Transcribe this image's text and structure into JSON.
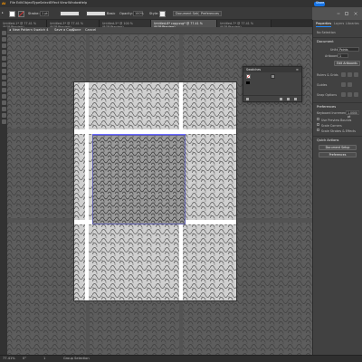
{
  "menubar": {
    "logo": "Ai",
    "items": [
      "File",
      "Edit",
      "Object",
      "Type",
      "Select",
      "Effect",
      "View",
      "Window",
      "Help"
    ],
    "share_label": "Share"
  },
  "controlbar": {
    "stroke_label": "Stroke:",
    "stroke_weight": "1 pt",
    "brush_label": "Basic",
    "opacity_label": "Opacity:",
    "opacity_value": "100%",
    "style_label": "Style:",
    "document_setup": "Document Setup",
    "preferences": "Preferences"
  },
  "tabs": [
    "Untitled-1* @ 77.41 % (RGB/Preview)",
    "Untitled-3* @ 77.41 % (RGB/Preview)",
    "Untitled-5* @ 100 % (RGB/Preview)",
    "Untitled-6* copy.svg* @ 77.41 % (RGB/Preview)",
    "Untitled-7* @ 77.41 % (RGB/Preview)"
  ],
  "isolation": {
    "pattern_name": "New Pattern Swatch 4",
    "save_copy": "Save a Copy",
    "done": "Done",
    "cancel": "Cancel"
  },
  "swatches_panel": {
    "title": "Swatches"
  },
  "right_panel": {
    "tabs": [
      "Properties",
      "Layers",
      "Libraries"
    ],
    "no_selection": "No Selection",
    "document_heading": "Document",
    "units_label": "Units",
    "units_value": "Points",
    "artboard_label": "Artboard",
    "artboard_value": "1",
    "edit_artboards": "Edit Artboards",
    "ruler_grids": "Rulers & Grids",
    "guides": "Guides",
    "snap_options": "Snap Options",
    "preferences_heading": "Preferences",
    "keyboard_increment_label": "Keyboard Increment",
    "keyboard_increment_value": "1.0000 pt",
    "use_preview_bounds": "Use Preview Bounds",
    "scale_corners": "Scale Corners",
    "scale_strokes": "Scale Strokes & Effects",
    "quick_actions": "Quick Actions",
    "document_setup": "Document Setup",
    "preferences_btn": "Preferences"
  },
  "statusbar": {
    "zoom": "77.41%",
    "rotation": "0°",
    "artboard": "1",
    "status": "Group Selection"
  },
  "colors": {
    "accent": "#1473e6",
    "canvas": "#535353",
    "chrome": "#323232"
  }
}
